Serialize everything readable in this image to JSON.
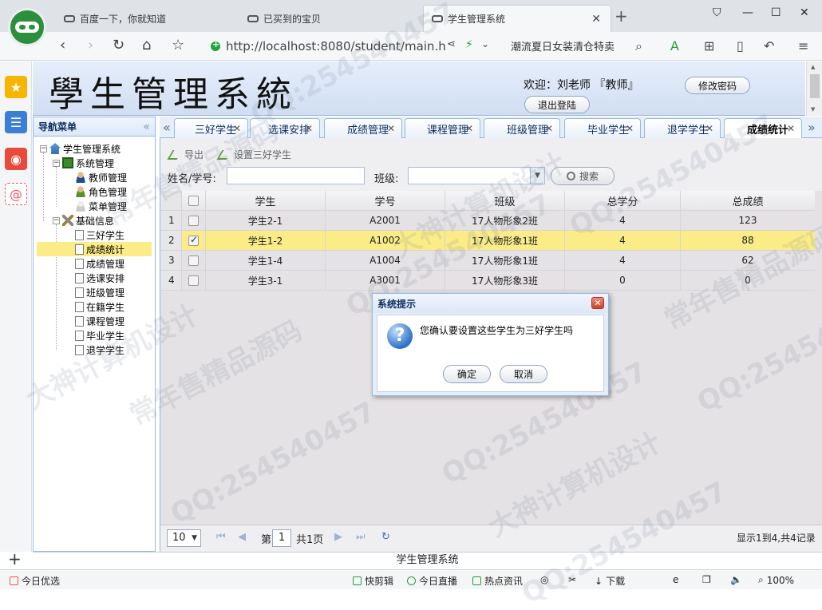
{
  "browser": {
    "tabs": [
      {
        "title": "百度一下，你就知道"
      },
      {
        "title": "已买到的宝贝"
      },
      {
        "title": "学生管理系统"
      }
    ],
    "url": "http://localhost:8080/student/main.h",
    "search_text": "潮流夏日女装清仓特卖",
    "status_left": "今日优选",
    "status_items": [
      "快剪辑",
      "今日直播",
      "热点资讯",
      "下载"
    ],
    "zoom": "100%"
  },
  "header": {
    "system_name": "學生管理系統",
    "welcome": "欢迎：刘老师 『教师』",
    "change_password": "修改密码",
    "logout": "退出登陆"
  },
  "nav": {
    "title": "导航菜单",
    "root": "学生管理系统",
    "system_group": "系统管理",
    "system_items": [
      "教师管理",
      "角色管理",
      "菜单管理"
    ],
    "base_group": "基础信息",
    "base_items": [
      "三好学生",
      "成绩统计",
      "成绩管理",
      "选课安排",
      "班级管理",
      "在籍学生",
      "课程管理",
      "毕业学生",
      "退学学生"
    ],
    "selected": "成绩统计"
  },
  "content_tabs": [
    "三好学生",
    "选课安排",
    "成绩管理",
    "课程管理",
    "班级管理",
    "毕业学生",
    "退学学生",
    "成绩统计"
  ],
  "active_tab": "成绩统计",
  "toolbar": {
    "export": "导出",
    "set_excellent": "设置三好学生",
    "name_label": "姓名/学号:",
    "class_label": "班级:",
    "search": "搜索"
  },
  "grid": {
    "columns": [
      "学生",
      "学号",
      "班级",
      "总学分",
      "总成绩"
    ],
    "rows": [
      {
        "num": "1",
        "checked": false,
        "student": "学生2-1",
        "id": "A2001",
        "class": "17人物形象2班",
        "credits": "4",
        "score": "123"
      },
      {
        "num": "2",
        "checked": true,
        "student": "学生1-2",
        "id": "A1002",
        "class": "17人物形象1班",
        "credits": "4",
        "score": "88"
      },
      {
        "num": "3",
        "checked": false,
        "student": "学生1-4",
        "id": "A1004",
        "class": "17人物形象1班",
        "credits": "4",
        "score": "62"
      },
      {
        "num": "4",
        "checked": false,
        "student": "学生3-1",
        "id": "A3001",
        "class": "17人物形象3班",
        "credits": "0",
        "score": "0"
      }
    ]
  },
  "pager": {
    "page_size": "10",
    "page_label": "第",
    "page_num": "1",
    "total_pages": "共1页",
    "summary": "显示1到4,共4记录"
  },
  "app_status": "学生管理系统",
  "dialog": {
    "title": "系统提示",
    "message": "您确认要设置这些学生为三好学生吗",
    "ok": "确定",
    "cancel": "取消"
  },
  "watermarks": [
    "QQ:254540457",
    "大神计算机设计",
    "常年售精品源码"
  ]
}
